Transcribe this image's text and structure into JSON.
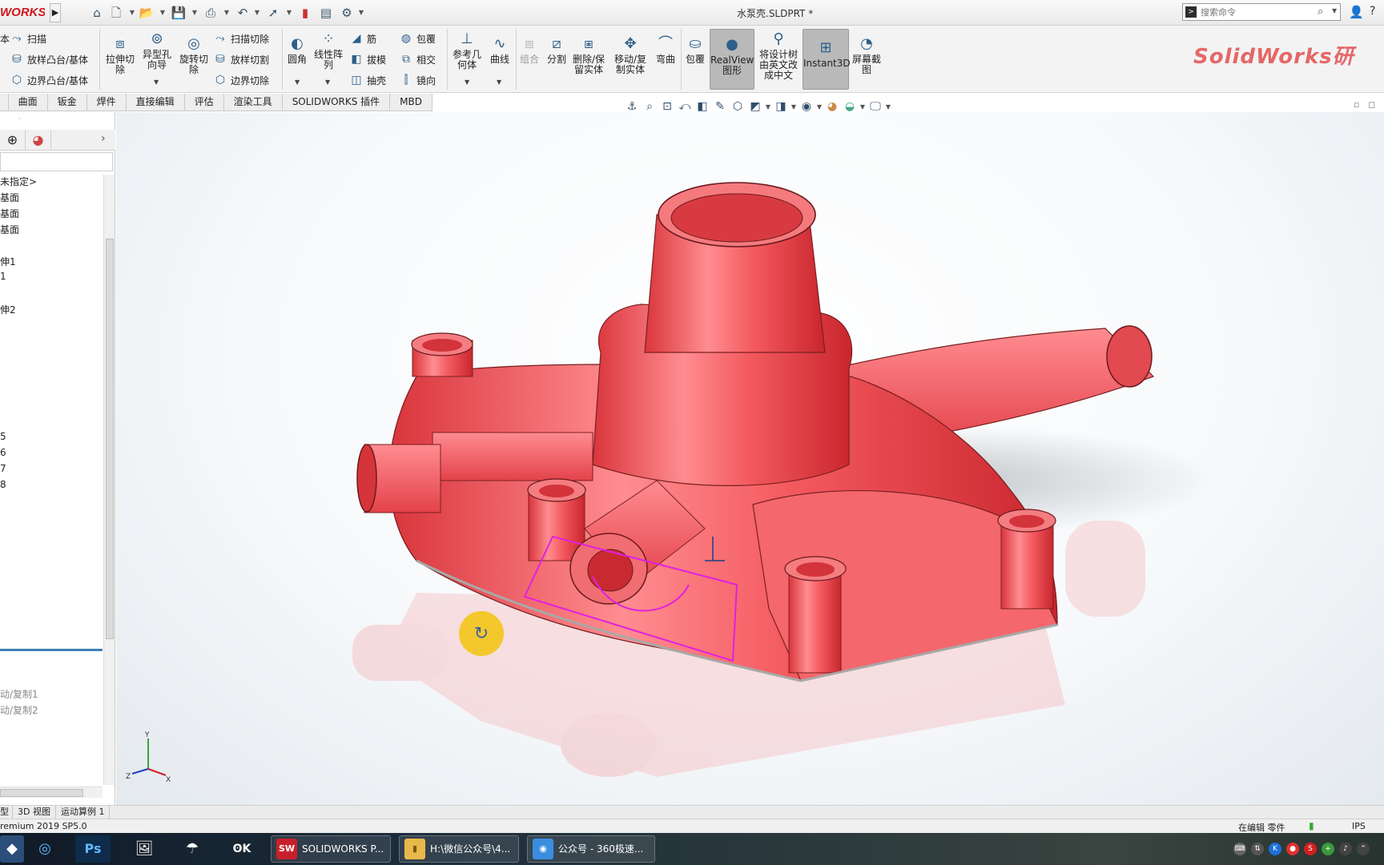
{
  "app": {
    "logo_text": "WORKS",
    "document_title": "水泵壳.SLDPRT *"
  },
  "quick_access": {
    "icons": [
      "home-icon",
      "new-document-icon",
      "open-folder-icon",
      "save-icon",
      "print-icon",
      "undo-icon",
      "select-cursor-icon",
      "rebuild-traffic-light-icon",
      "file-properties-icon",
      "options-gear-icon"
    ]
  },
  "search": {
    "placeholder": "搜索命令"
  },
  "ribbon": {
    "group1": [
      "扫描",
      "放样凸台/基体",
      "边界凸台/基体"
    ],
    "left_clip": [
      "本"
    ],
    "buttons_big": [
      "拉伸切除",
      "异型孔向导",
      "旋转切除"
    ],
    "cut_group": [
      "扫描切除",
      "放样切割",
      "边界切除"
    ],
    "fillet": "圆角",
    "pattern": "线性阵列",
    "features_col": [
      "筋",
      "拔模",
      "抽壳"
    ],
    "features_col2": [
      "包覆",
      "相交",
      "镜向"
    ],
    "ref_geometry": "参考几何体",
    "curves": "曲线",
    "combine": "组合",
    "split": "分割",
    "delete_keep": "删除/保留实体",
    "move_copy": "移动/复制实体",
    "flex": "弯曲",
    "wrap": "包覆",
    "realview": "RealView图形",
    "translate": "将设计树由英文改成中文",
    "instant3d": "Instant3D",
    "screenshot": "屏幕截图",
    "watermark": "SolidWorks研"
  },
  "tabs": [
    "",
    "曲面",
    "钣金",
    "焊件",
    "直接编辑",
    "评估",
    "渲染工具",
    "SOLIDWORKS 插件",
    "MBD"
  ],
  "feature_tree": {
    "items": [
      {
        "label": "未指定>",
        "grey": false
      },
      {
        "label": "基面",
        "grey": false
      },
      {
        "label": "基面",
        "grey": false
      },
      {
        "label": "基面",
        "grey": false
      },
      {
        "label": "伸1",
        "grey": false
      },
      {
        "label": "1",
        "grey": false
      },
      {
        "label": "伸2",
        "grey": false
      },
      {
        "label": "5",
        "grey": false
      },
      {
        "label": "6",
        "grey": false
      },
      {
        "label": "7",
        "grey": false
      },
      {
        "label": "8",
        "grey": false
      },
      {
        "label": "动/复制1",
        "grey": true
      },
      {
        "label": "动/复制2",
        "grey": true
      }
    ]
  },
  "bottom_tabs": [
    "型",
    "3D 视图",
    "运动算例 1"
  ],
  "status": {
    "version": "remium 2019 SP5.0",
    "mode": "在编辑 零件",
    "units": "IPS"
  },
  "taskbar": {
    "tasks": [
      {
        "label": "SOLIDWORKS P...",
        "icon": "SW",
        "color": "#c8202a"
      },
      {
        "label": "H:\\微信公众号\\4...",
        "icon": "📁",
        "color": "#e8b84a"
      },
      {
        "label": "公众号 - 360极速...",
        "icon": "◉",
        "color": "#3b8de0"
      }
    ]
  },
  "colors": {
    "model": "#f05a5e",
    "accent_red": "#d0161c",
    "selection": "#e020e0"
  }
}
